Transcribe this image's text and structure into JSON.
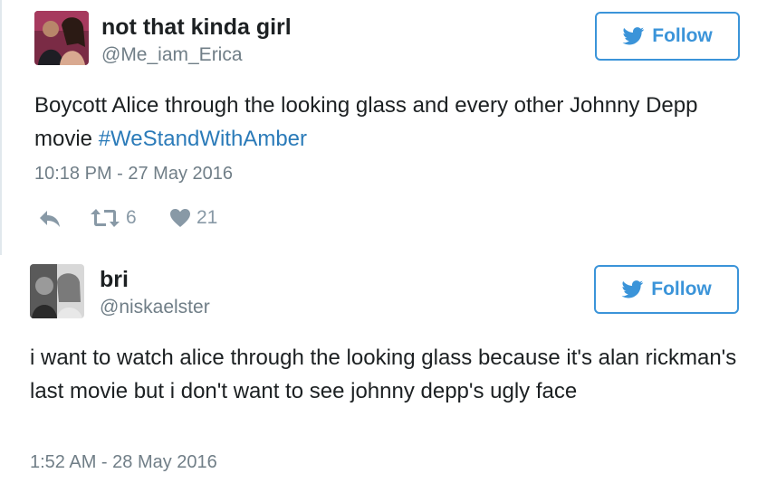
{
  "tweets": [
    {
      "author_name": "not that kinda girl",
      "author_handle": "@Me_iam_Erica",
      "follow_label": "Follow",
      "text_before": "Boycott Alice through the looking glass and every other Johnny Depp movie ",
      "hashtag": "#WeStandWithAmber",
      "timestamp": "10:18 PM - 27 May 2016",
      "retweet_count": "6",
      "like_count": "21"
    },
    {
      "author_name": "bri",
      "author_handle": "@niskaelster",
      "follow_label": "Follow",
      "text": "i want to watch alice through the looking glass because it's alan rickman's last movie but i don't want to see johnny depp's ugly face",
      "timestamp": "1:52 AM - 28 May 2016"
    }
  ],
  "icons": {
    "follow": "twitter-bird-icon",
    "reply": "reply-icon",
    "retweet": "retweet-icon",
    "like": "heart-icon"
  },
  "colors": {
    "accent": "#3b94d9",
    "hashtag": "#2b7bb9",
    "muted": "#707e87",
    "action": "#8899a6",
    "text": "#1c2022"
  }
}
